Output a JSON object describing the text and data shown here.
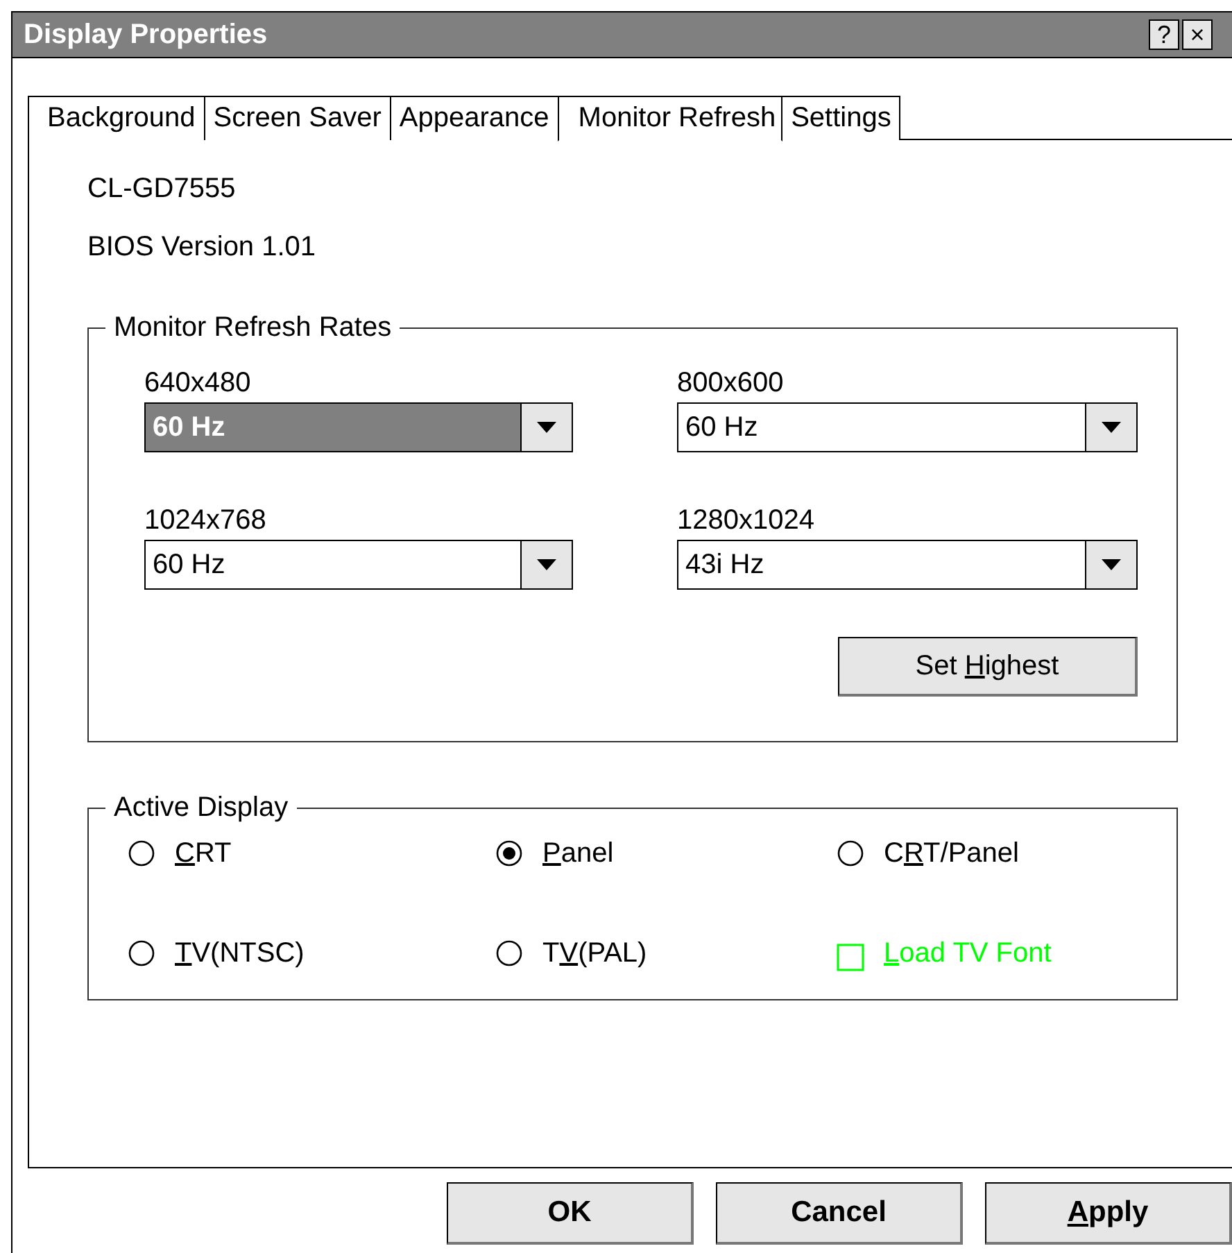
{
  "window": {
    "title": "Display Properties",
    "title_buttons": [
      "?",
      "×"
    ]
  },
  "tabs": [
    {
      "label": "Background",
      "selected": false
    },
    {
      "label": "Screen Saver",
      "selected": false
    },
    {
      "label": "Appearance",
      "selected": false
    },
    {
      "label": "Monitor Refresh",
      "selected": true
    },
    {
      "label": "Settings",
      "selected": false
    }
  ],
  "info": [
    "CL-GD7555",
    "BIOS Version 1.01"
  ],
  "refresh_group": {
    "legend": "Monitor Refresh Rates",
    "rates": [
      {
        "resolution": "640x480",
        "value": "60 Hz",
        "selected": true
      },
      {
        "resolution": "800x600",
        "value": "60 Hz",
        "selected": false
      },
      {
        "resolution": "1024x768",
        "value": "60 Hz",
        "selected": false
      },
      {
        "resolution": "1280x1024",
        "value": "43i Hz",
        "selected": false
      }
    ],
    "button": {
      "pre": "Set ",
      "key": "H",
      "post": "ighest"
    }
  },
  "display_group": {
    "legend": "Active Display",
    "options": [
      {
        "kind": "radio",
        "key": "C",
        "post": "RT",
        "checked": false
      },
      {
        "kind": "radio",
        "key": "P",
        "post": "anel",
        "checked": true
      },
      {
        "kind": "radio",
        "pre": "C",
        "key": "R",
        "post": "T/Panel",
        "checked": false
      },
      {
        "kind": "radio",
        "key": "T",
        "post": "V(NTSC)",
        "checked": false
      },
      {
        "kind": "radio",
        "pre": "T",
        "key": "V",
        "post": "(PAL)",
        "checked": false
      },
      {
        "kind": "checkbox",
        "key": "L",
        "post": "oad TV Font",
        "checked": false,
        "color": "#00ff00"
      }
    ]
  },
  "buttons": [
    {
      "post": "OK"
    },
    {
      "post": "Cancel"
    },
    {
      "key": "A",
      "post": "pply"
    }
  ]
}
